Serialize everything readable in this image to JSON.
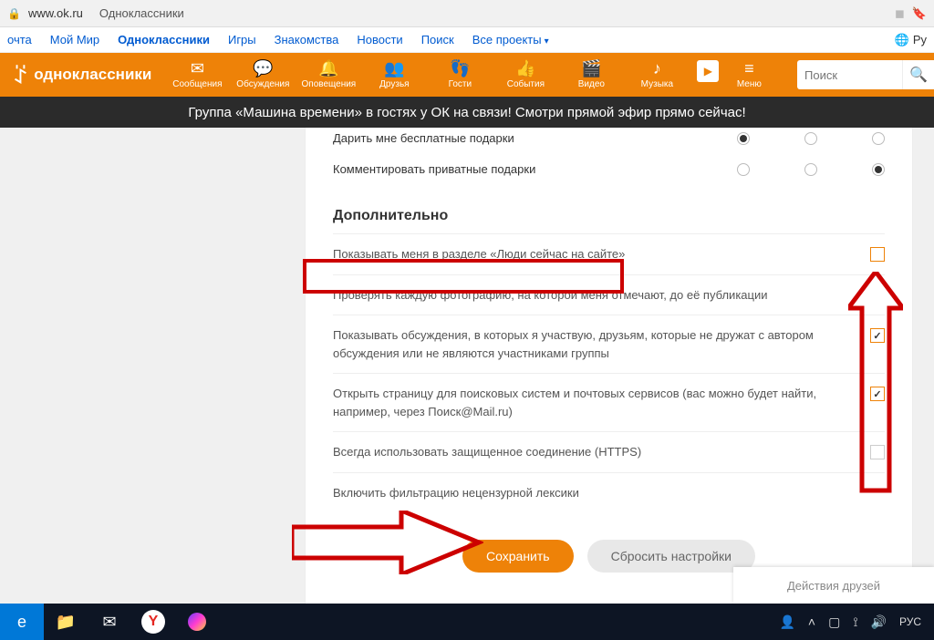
{
  "browser": {
    "url": "www.ok.ru",
    "page_title": "Одноклассники"
  },
  "mailru_nav": {
    "items": [
      "очта",
      "Мой Мир",
      "Одноклассники",
      "Игры",
      "Знакомства",
      "Новости",
      "Поиск",
      "Все проекты"
    ],
    "active_index": 2,
    "lang": "Ру"
  },
  "ok_header": {
    "logo": "одноклассники",
    "nav": [
      {
        "icon": "✉",
        "label": "Сообщения"
      },
      {
        "icon": "💬",
        "label": "Обсуждения"
      },
      {
        "icon": "🔔",
        "label": "Оповещения"
      },
      {
        "icon": "👥",
        "label": "Друзья"
      },
      {
        "icon": "👣",
        "label": "Гости"
      },
      {
        "icon": "👍",
        "label": "События"
      },
      {
        "icon": "🎬",
        "label": "Видео"
      },
      {
        "icon": "♪",
        "label": "Музыка"
      }
    ],
    "menu_label": "Меню",
    "search_placeholder": "Поиск"
  },
  "banner": "Группа «Машина времени» в гостях у ОК на связи! Смотри прямой эфир прямо сейчас!",
  "settings": {
    "radio_rows": [
      {
        "label": "Дарить мне бесплатные подарки",
        "selected": 0
      },
      {
        "label": "Комментировать приватные подарки",
        "selected": 1
      }
    ],
    "additional_header": "Дополнительно",
    "check_rows": [
      {
        "label": "Показывать меня в разделе «Люди сейчас на сайте»",
        "checked": false
      },
      {
        "label": "Проверять каждую фотографию, на которой меня отмечают, до её публикации",
        "checked": null
      },
      {
        "label": "Показывать обсуждения, в которых я участвую, друзьям, которые не дружат с автором обсуждения или не являются участниками группы",
        "checked": true
      },
      {
        "label": "Открыть страницу для поисковых систем и почтовых сервисов (вас можно будет найти, например, через Поиск@Mail.ru)",
        "checked": true
      },
      {
        "label": "Всегда использовать защищенное соединение (HTTPS)",
        "checked": false
      },
      {
        "label": "Включить фильтрацию нецензурной лексики",
        "checked": null
      }
    ],
    "save_label": "Сохранить",
    "reset_label": "Сбросить настройки"
  },
  "friends_activity": "Действия друзей",
  "taskbar": {
    "lang": "РУС"
  }
}
